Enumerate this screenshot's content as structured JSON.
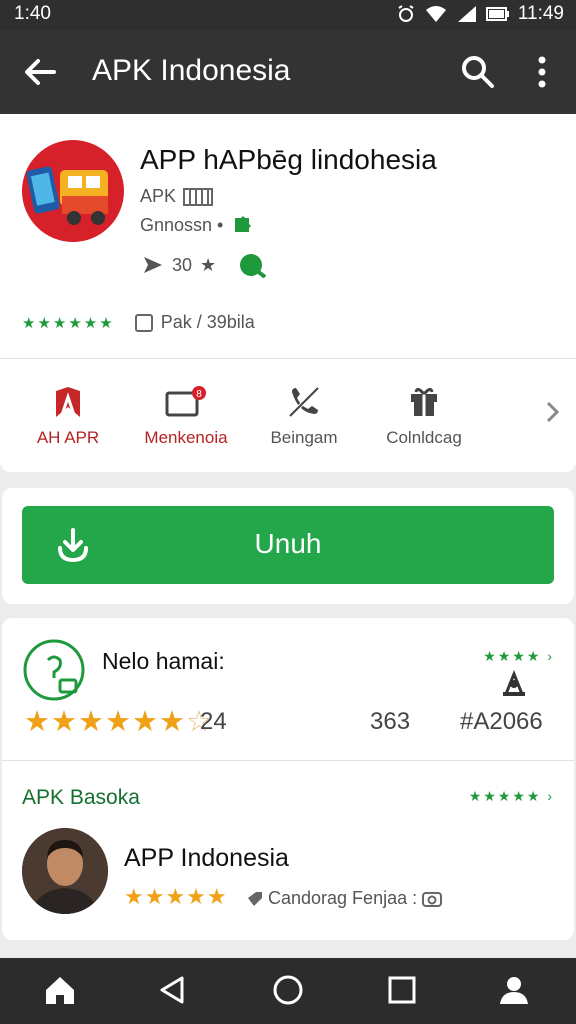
{
  "status_bar": {
    "time": "1:40",
    "clock_right": "11:49"
  },
  "app_bar": {
    "title": "APK Indonesia",
    "back_icon": "arrow-back-icon",
    "search_icon": "search-icon",
    "more_icon": "more-vert-icon"
  },
  "app": {
    "name": "APP hAPbēg lindohesia",
    "developer": "APK",
    "category": "Gnnossn •",
    "meta_count": "30",
    "rating_label": "Pak / 39bila"
  },
  "actions": [
    {
      "label": "AH APR",
      "icon": "bookmark-icon",
      "color": "#c62828"
    },
    {
      "label": "Menkenoia",
      "icon": "notification-icon",
      "color": "#c62828"
    },
    {
      "label": "Beingam",
      "icon": "phone-off-icon",
      "color": "#555555"
    },
    {
      "label": "Colnldcag",
      "icon": "gift-icon",
      "color": "#555555"
    }
  ],
  "install": {
    "label": "Unuh",
    "icon": "download-icon",
    "color": "#23a74a"
  },
  "reviews": {
    "title": "Nelo hamai:",
    "score": "24",
    "count": "363",
    "id": "#A2066",
    "stars_filled": 6.5,
    "stars_total": 7
  },
  "section": {
    "title": "APK Basoka",
    "user_name": "APP Indonesia",
    "user_stars": 5,
    "user_note": "Candorag Fenjaa :"
  },
  "nav_icons": [
    "home-icon",
    "back-triangle-icon",
    "home-circle-icon",
    "recents-icon",
    "profile-icon"
  ],
  "colors": {
    "accent_green": "#23a74a",
    "dark_bar": "#333333",
    "star_orange": "#f0a118",
    "brand_red": "#d6202a"
  }
}
